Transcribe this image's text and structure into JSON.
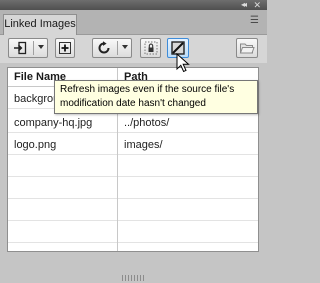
{
  "panel": {
    "title_controls": {
      "collapse": "◂◂",
      "close": "✕"
    },
    "tab": {
      "label": "Linked Images"
    },
    "menu_icon": "☰"
  },
  "toolbar": {
    "buttons": [
      {
        "name": "import-image",
        "icon": "import-icon",
        "dropdown": true
      },
      {
        "name": "add-image",
        "icon": "plus-icon",
        "dropdown": false
      },
      {
        "name": "refresh",
        "icon": "refresh-icon",
        "dropdown": true
      },
      {
        "name": "lock-image",
        "icon": "lock-icon",
        "dropdown": false
      },
      {
        "name": "force-refresh",
        "icon": "force-refresh-icon",
        "dropdown": false,
        "active": true
      },
      {
        "name": "open-folder",
        "icon": "folder-icon",
        "dropdown": false
      }
    ]
  },
  "table": {
    "columns": [
      "File Name",
      "Path"
    ],
    "rows": [
      {
        "file_name": "backgrou",
        "path": ""
      },
      {
        "file_name": "company-hq.jpg",
        "path": "../photos/"
      },
      {
        "file_name": "logo.png",
        "path": "images/"
      }
    ]
  },
  "tooltip": {
    "line1": "Refresh images even if the source file's",
    "line2": "modification date hasn't changed"
  },
  "colors": {
    "panel_bg": "#c5c5c5",
    "toolbar_bg": "#d6d6d6",
    "tooltip_bg": "#ffffe1",
    "active_button_border": "#3e8cd9"
  }
}
